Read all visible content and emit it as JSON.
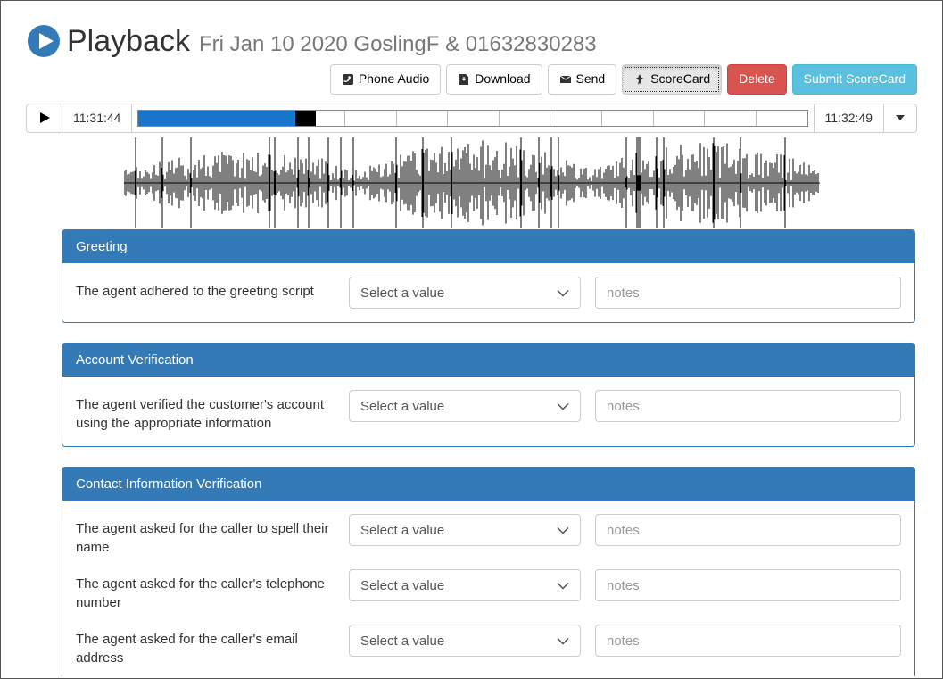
{
  "header": {
    "title": "Playback",
    "subtitle": "Fri Jan 10 2020 GoslingF & 01632830283"
  },
  "toolbar": {
    "phone_audio": "Phone Audio",
    "download": "Download",
    "send": "Send",
    "scorecard": "ScoreCard",
    "delete": "Delete",
    "submit": "Submit ScoreCard"
  },
  "player": {
    "time_start": "11:31:44",
    "time_end": "11:32:49",
    "progress_percent": 23.5,
    "tick_count": 13
  },
  "scorecard": {
    "select_placeholder": "Select a value",
    "notes_placeholder": "notes",
    "sections": [
      {
        "title": "Greeting",
        "questions": [
          "The agent adhered to the greeting script"
        ]
      },
      {
        "title": "Account Verification",
        "questions": [
          "The agent verified the customer's account using the appropriate information"
        ]
      },
      {
        "title": "Contact Information Verification",
        "questions": [
          "The agent asked for the caller to spell their name",
          "The agent asked for the caller's telephone number",
          "The agent asked for the caller's email address"
        ]
      }
    ]
  }
}
